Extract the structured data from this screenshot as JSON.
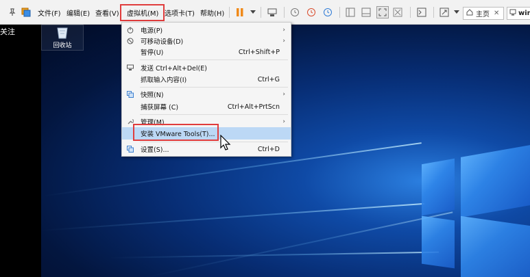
{
  "toolbar": {
    "menus": {
      "file": "文件(F)",
      "edit": "编辑(E)",
      "view": "查看(V)",
      "vm": "虚拟机(M)",
      "tabs": "选项卡(T)",
      "help": "帮助(H)"
    },
    "tabs": {
      "home": "主页",
      "vm_tab": "win"
    }
  },
  "left_panel": {
    "text": "关注"
  },
  "desktop": {
    "recycle_bin_label": "回收站"
  },
  "vm_menu": {
    "items": [
      {
        "icon": "power-icon",
        "label": "电源(P)",
        "shortcut": "",
        "submenu": true
      },
      {
        "icon": "removable-device-icon",
        "label": "可移动设备(D)",
        "shortcut": "",
        "submenu": true
      },
      {
        "icon": "",
        "label": "暂停(U)",
        "shortcut": "Ctrl+Shift+P",
        "submenu": false
      },
      {
        "icon": "send-keys-icon",
        "label": "发送 Ctrl+Alt+Del(E)",
        "shortcut": "",
        "submenu": false
      },
      {
        "icon": "",
        "label": "抓取输入内容(I)",
        "shortcut": "Ctrl+G",
        "submenu": false
      },
      {
        "icon": "snapshot-icon",
        "label": "快照(N)",
        "shortcut": "",
        "submenu": true
      },
      {
        "icon": "",
        "label": "捕获屏幕 (C)",
        "shortcut": "Ctrl+Alt+PrtScn",
        "submenu": false
      },
      {
        "icon": "wrench-icon",
        "label": "管理(M)",
        "shortcut": "",
        "submenu": true
      },
      {
        "icon": "",
        "label": "安装 VMware Tools(T)...",
        "shortcut": "",
        "submenu": false
      },
      {
        "icon": "settings-icon",
        "label": "设置(S)...",
        "shortcut": "Ctrl+D",
        "submenu": false
      }
    ]
  },
  "colors": {
    "highlight_border": "#e03c3c",
    "menu_hover": "#bcd8f5"
  }
}
